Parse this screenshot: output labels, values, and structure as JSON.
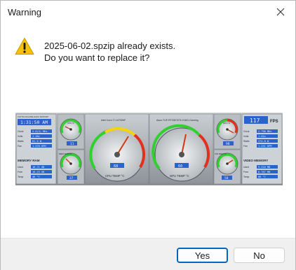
{
  "window": {
    "title": "Warning"
  },
  "message": {
    "line1": "2025-06-02.spzip already exists.",
    "line2": "Do you want to replace it?"
  },
  "icons": {
    "warning": "warning-triangle-icon",
    "close": "close-icon"
  },
  "preview": {
    "time": "1:31:50 AM",
    "left_panel": {
      "header": "SOFTPLAN HOME AUDIO SUPPORT",
      "rows": [
        {
          "label": "Clock",
          "value": "5.0(3) MHz"
        },
        {
          "label": "Volts",
          "value": "1.18v"
        },
        {
          "label": "Watts",
          "value": "61.5 W"
        },
        {
          "label": "Fan",
          "value": "1.578 RPM"
        }
      ],
      "memory_header": "MEMORY RAM",
      "memory_rows": [
        {
          "label": "Used",
          "value": "16.71 GB"
        },
        {
          "label": "Free",
          "value": "16.23 GB"
        },
        {
          "label": "Temp",
          "value": "46 °C"
        }
      ]
    },
    "cpu_gauge": {
      "name": "Intel Core i7-14700KF",
      "label": "CPU TEMP °C",
      "value": "68",
      "ticks": [
        "0",
        "10",
        "20",
        "30",
        "40",
        "50",
        "60",
        "70",
        "80",
        "90",
        "100"
      ]
    },
    "gpu_gauge": {
      "name": "Asus TUF-RTX5070Ti-O16G-Gaming",
      "label": "GPU TEMP °C",
      "value": "60",
      "ticks": [
        "0",
        "10",
        "20",
        "30",
        "40",
        "50",
        "60",
        "70",
        "80",
        "90",
        "100"
      ]
    },
    "small_gauges": {
      "cpu_pct": {
        "label": "CPU %",
        "value": "11"
      },
      "mem_ram": {
        "label": "MEM RAM %",
        "value": "37"
      },
      "gpu_pct": {
        "label": "GPU %",
        "value": "98"
      },
      "vid_mem": {
        "label": "VID MEM %",
        "value": "58"
      }
    },
    "right_panel": {
      "fps": "117",
      "fps_label": "FPS",
      "rows": [
        {
          "label": "Clock",
          "value": "2.790 MHz"
        },
        {
          "label": "Volts",
          "value": "1.02v"
        },
        {
          "label": "Watts",
          "value": "274.0 W"
        },
        {
          "label": "Fan",
          "value": "1.531 RPM"
        }
      ],
      "memory_header": "VIDEO MEMORY",
      "memory_rows": [
        {
          "label": "Used",
          "value": "9.510 MB"
        },
        {
          "label": "Free",
          "value": "6.787 MB"
        },
        {
          "label": "Temp",
          "value": "86 °C"
        }
      ]
    }
  },
  "buttons": {
    "yes": "Yes",
    "no": "No"
  },
  "colors": {
    "accent": "#0067c0",
    "warning_fill": "#f4c20d",
    "panel_blue": "#2a63c9"
  }
}
